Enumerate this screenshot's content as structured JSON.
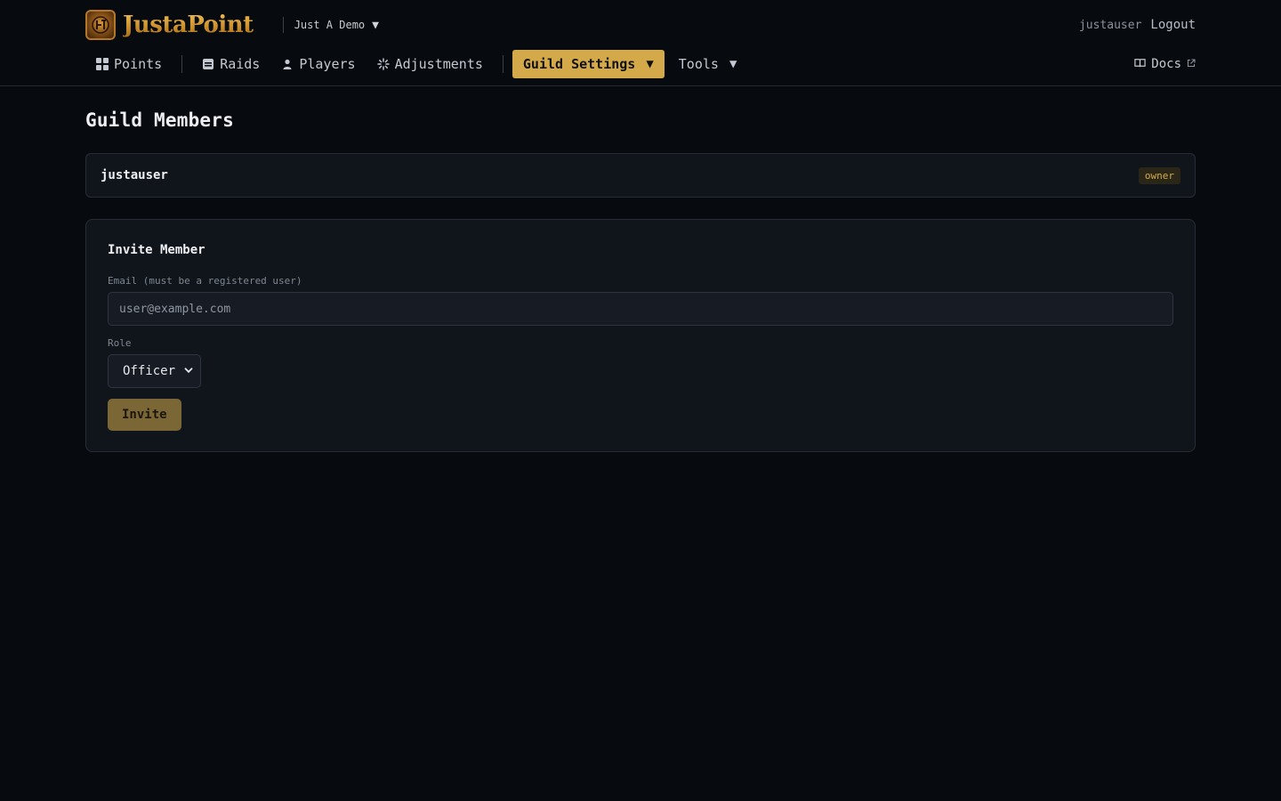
{
  "header": {
    "brand": "JustaPoint",
    "guild_selector": "Just A Demo",
    "username": "justauser",
    "logout_label": "Logout"
  },
  "nav": {
    "items": [
      {
        "label": "Points",
        "icon": "grid-icon"
      },
      {
        "label": "Raids",
        "icon": "raid-icon"
      },
      {
        "label": "Players",
        "icon": "user-icon"
      },
      {
        "label": "Adjustments",
        "icon": "sparkle-icon"
      }
    ],
    "guild_settings": "Guild Settings",
    "tools": "Tools",
    "docs": "Docs"
  },
  "main": {
    "title": "Guild Members",
    "members": [
      {
        "name": "justauser",
        "role": "owner"
      }
    ],
    "invite": {
      "title": "Invite Member",
      "email_label": "Email (must be a registered user)",
      "email_placeholder": "user@example.com",
      "role_label": "Role",
      "role_selected": "Officer",
      "button": "Invite"
    }
  },
  "colors": {
    "background": "#070a0e",
    "card": "#10141b",
    "accent": "#d4a94a",
    "invite_button": "#7a6735"
  }
}
